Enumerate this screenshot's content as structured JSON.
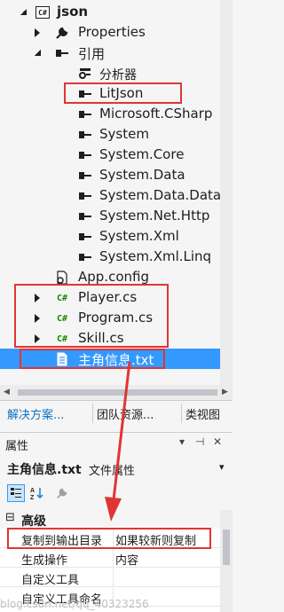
{
  "explorer": {
    "project": "json",
    "project_icon": "C#",
    "items": [
      {
        "label": "Properties",
        "icon": "wrench-icon"
      },
      {
        "label": "引用",
        "icon": "reference-icon"
      },
      {
        "label": "分析器",
        "icon": "analyzer-icon"
      },
      {
        "label": "LitJson",
        "icon": "reference-icon"
      },
      {
        "label": "Microsoft.CSharp",
        "icon": "reference-icon"
      },
      {
        "label": "System",
        "icon": "reference-icon"
      },
      {
        "label": "System.Core",
        "icon": "reference-icon"
      },
      {
        "label": "System.Data",
        "icon": "reference-icon"
      },
      {
        "label": "System.Data.DataSet",
        "icon": "reference-icon"
      },
      {
        "label": "System.Net.Http",
        "icon": "reference-icon"
      },
      {
        "label": "System.Xml",
        "icon": "reference-icon"
      },
      {
        "label": "System.Xml.Linq",
        "icon": "reference-icon"
      },
      {
        "label": "App.config",
        "icon": "config-icon"
      },
      {
        "label": "Player.cs",
        "icon": "csharp-file-icon"
      },
      {
        "label": "Program.cs",
        "icon": "csharp-file-icon"
      },
      {
        "label": "Skill.cs",
        "icon": "csharp-file-icon"
      },
      {
        "label": "主角信息.txt",
        "icon": "text-file-icon"
      }
    ],
    "cs_glyph": "C#"
  },
  "tabs": [
    {
      "label": "解决方案..."
    },
    {
      "label": "团队资源..."
    },
    {
      "label": "类视图"
    }
  ],
  "properties": {
    "title": "属性",
    "pin_glyph": "▾ ⊣ ✕",
    "object_name": "主角信息.txt",
    "object_type": "文件属性",
    "category": "高级",
    "category_toggle": "⊟",
    "rows": [
      {
        "key": "复制到输出目录",
        "value": "如果较新则复制"
      },
      {
        "key": "生成操作",
        "value": "内容"
      },
      {
        "key": "自定义工具",
        "value": ""
      },
      {
        "key": "自定义工具命名",
        "value": ""
      }
    ]
  },
  "watermark": "blog.csdn.net/qq_40323256",
  "colors": {
    "selection": "#3399ff",
    "highlight": "#e03535",
    "accent": "#0e70c0"
  }
}
